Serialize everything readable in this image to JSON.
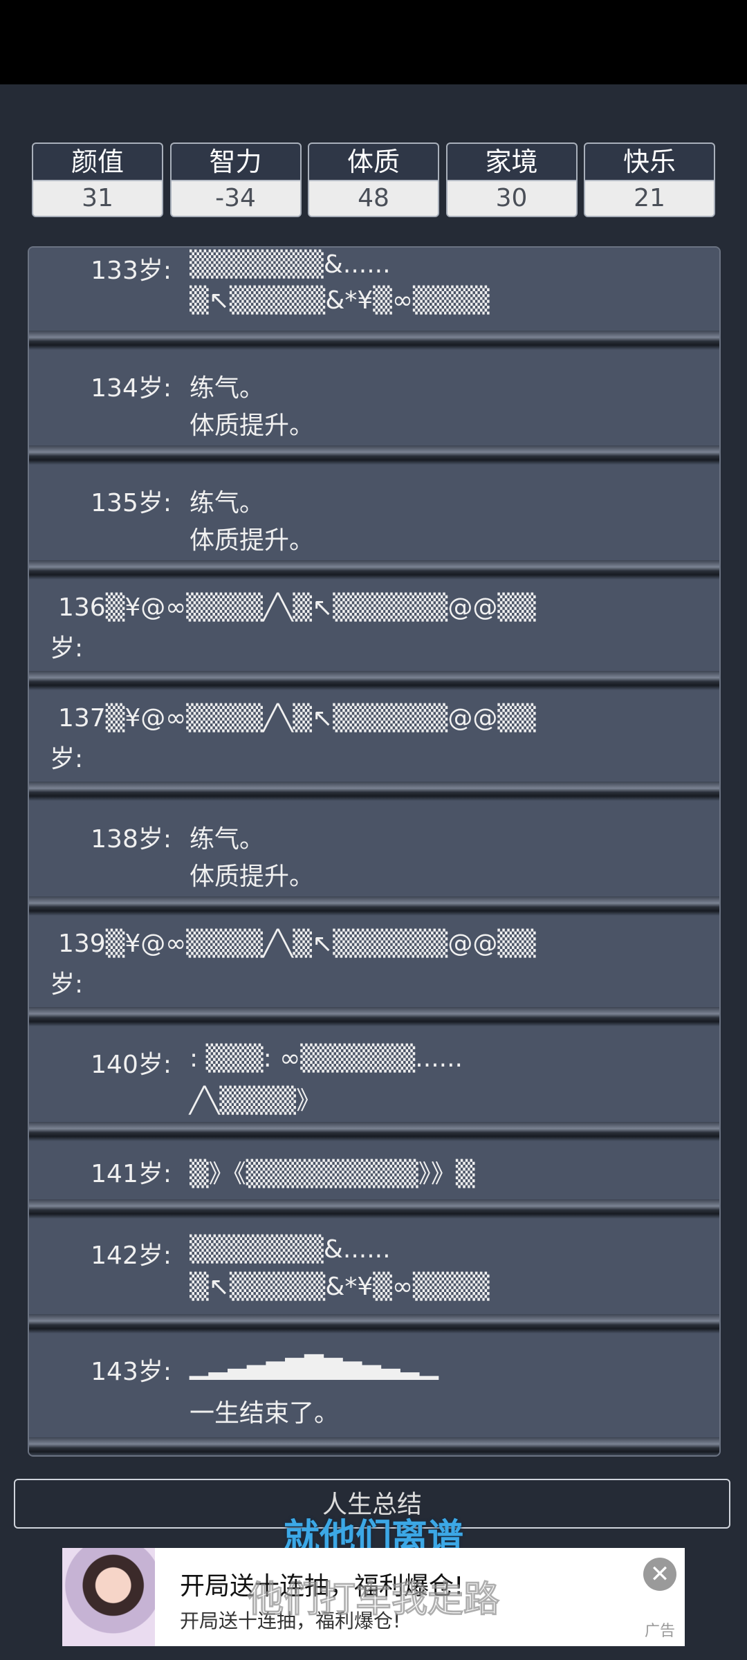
{
  "stats": [
    {
      "label": "颜值",
      "value": "31"
    },
    {
      "label": "智力",
      "value": "-34"
    },
    {
      "label": "体质",
      "value": "48"
    },
    {
      "label": "家境",
      "value": "30"
    },
    {
      "label": "快乐",
      "value": "21"
    }
  ],
  "log": {
    "e133": {
      "age": "133岁:",
      "line1": "▒▒▒▒▒▒▒&......",
      "line2": "▒↖▒▒▒▒▒&*¥▒∞▒▒▒▒"
    },
    "e134": {
      "age": "134岁:",
      "line1": "练气。",
      "line2": "体质提升。"
    },
    "e135": {
      "age": "135岁:",
      "line1": "练气。",
      "line2": "体质提升。"
    },
    "e136": {
      "line1": "136▒¥@∞▒▒▒▒╱╲▒↖▒▒▒▒▒▒@@▒▒",
      "line2": "岁:"
    },
    "e137": {
      "line1": "137▒¥@∞▒▒▒▒╱╲▒↖▒▒▒▒▒▒@@▒▒",
      "line2": "岁:"
    },
    "e138": {
      "age": "138岁:",
      "line1": "练气。",
      "line2": "体质提升。"
    },
    "e139": {
      "line1": "139▒¥@∞▒▒▒▒╱╲▒↖▒▒▒▒▒▒@@▒▒",
      "line2": "岁:"
    },
    "e140": {
      "age": "140岁:",
      "line1": ": ▒▒▒: ∞▒▒▒▒▒▒......",
      "line2": "╱╲▒▒▒▒》"
    },
    "e141": {
      "age": "141岁:",
      "line1": "▒》《▒▒▒▒▒▒▒▒▒》》▒"
    },
    "e142": {
      "age": "142岁:",
      "line1": "▒▒▒▒▒▒▒&......",
      "line2": "▒↖▒▒▒▒▒&*¥▒∞▒▒▒▒"
    },
    "e143": {
      "age": "143岁:",
      "line1": "▁▂▃▄▅▆▇▆▅▄▃▂▁",
      "line2": "一生结束了。"
    }
  },
  "summary_label": "人生总结",
  "subtitle": "就他们离谱",
  "ad": {
    "title": "开局送十连抽，福利爆仓!",
    "desc": "开局送十连抽，福利爆仓!",
    "tag": "广告",
    "overlay": "他们打车我走路"
  },
  "icons": {
    "close": "close-icon",
    "ad_image": "ad-girl-avatar"
  }
}
